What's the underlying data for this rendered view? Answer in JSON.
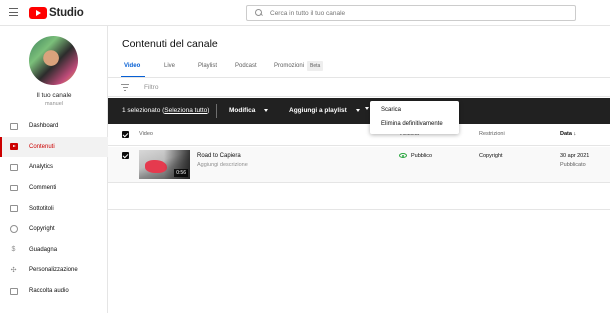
{
  "app": {
    "name": "Studio"
  },
  "search": {
    "placeholder": "Cerca in tutto il tuo canale"
  },
  "sidebar": {
    "channel_name": "Il tuo canale",
    "channel_handle": "manuel",
    "items": [
      {
        "label": "Dashboard",
        "icon": "dashboard-icon"
      },
      {
        "label": "Contenuti",
        "icon": "content-icon",
        "active": true
      },
      {
        "label": "Analytics",
        "icon": "analytics-icon"
      },
      {
        "label": "Commenti",
        "icon": "comments-icon"
      },
      {
        "label": "Sottotitoli",
        "icon": "subtitles-icon"
      },
      {
        "label": "Copyright",
        "icon": "copyright-icon"
      },
      {
        "label": "Guadagna",
        "icon": "earn-icon"
      },
      {
        "label": "Personalizzazione",
        "icon": "customization-icon"
      },
      {
        "label": "Raccolta audio",
        "icon": "audio-library-icon"
      }
    ]
  },
  "main": {
    "title": "Contenuti del canale",
    "tabs": [
      {
        "label": "Video",
        "active": true
      },
      {
        "label": "Live"
      },
      {
        "label": "Playlist"
      },
      {
        "label": "Podcast"
      },
      {
        "label": "Promozioni"
      }
    ],
    "beta_badge": "Beta",
    "filter_label": "Filtro"
  },
  "action_bar": {
    "selected_text": "1 selezionato (",
    "select_all": "Seleziona tutto",
    "selected_close": ")",
    "edit_label": "Modifica",
    "add_playlist_label": "Aggiungi a playlist"
  },
  "table": {
    "headers": {
      "video": "Video",
      "visibility": "Visibilità",
      "restrictions": "Restrizioni",
      "date": "Data"
    },
    "rows": [
      {
        "title": "Road to Capiera",
        "description": "Aggiungi descrizione",
        "duration": "0:56",
        "visibility": "Pubblico",
        "restrictions": "Copyright",
        "date": "30 apr 2021",
        "date_status": "Pubblicato"
      }
    ]
  },
  "dropdown": {
    "items": [
      "Scarica",
      "Elimina definitivamente"
    ]
  },
  "colors": {
    "brand_red": "#ff0000",
    "active_red": "#cc0000",
    "link_blue": "#065fd4",
    "public_green": "#2ba640"
  }
}
